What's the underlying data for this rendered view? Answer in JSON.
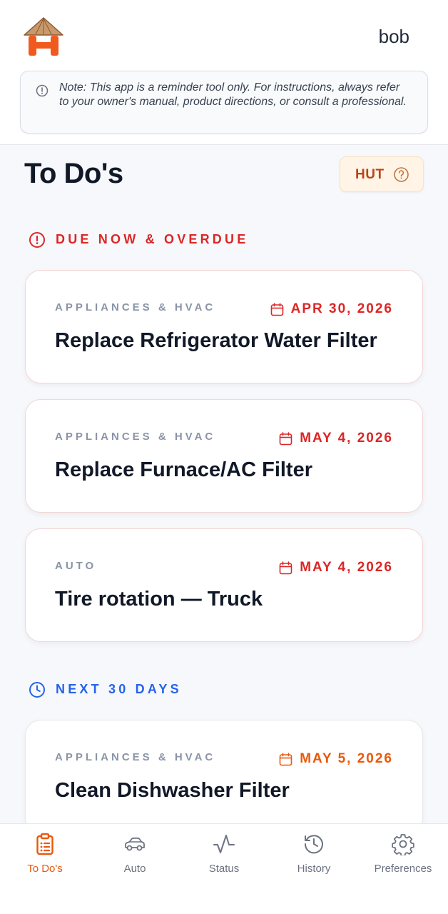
{
  "header": {
    "username": "bob"
  },
  "note": {
    "text": "Note: This app is a reminder tool only. For instructions, always refer to your owner's manual, product directions, or consult a professional."
  },
  "main": {
    "title": "To Do's",
    "hut_label": "HUT",
    "sections": {
      "overdue": {
        "label": "DUE NOW & OVERDUE",
        "color": "#dc2626"
      },
      "next": {
        "label": "NEXT 30 DAYS",
        "color": "#2563eb"
      }
    },
    "cards": [
      {
        "category": "APPLIANCES & HVAC",
        "date": "APR 30, 2026",
        "title": "Replace Refrigerator Water Filter"
      },
      {
        "category": "APPLIANCES & HVAC",
        "date": "MAY 4, 2026",
        "title": "Replace Furnace/AC Filter"
      },
      {
        "category": "AUTO",
        "date": "MAY 4, 2026",
        "title": "Tire rotation — Truck"
      },
      {
        "category": "APPLIANCES & HVAC",
        "date": "MAY 5, 2026",
        "title": "Clean Dishwasher Filter"
      }
    ]
  },
  "nav": {
    "items": [
      {
        "label": "To Do's",
        "icon": "clipboard-list-icon",
        "active": true
      },
      {
        "label": "Auto",
        "icon": "car-icon",
        "active": false
      },
      {
        "label": "Status",
        "icon": "activity-icon",
        "active": false
      },
      {
        "label": "History",
        "icon": "history-icon",
        "active": false
      },
      {
        "label": "Preferences",
        "icon": "gear-icon",
        "active": false
      }
    ]
  },
  "colors": {
    "accent": "#ea580c",
    "overdue": "#dc2626",
    "upcoming": "#2563eb",
    "hut_text": "#b8461a"
  }
}
